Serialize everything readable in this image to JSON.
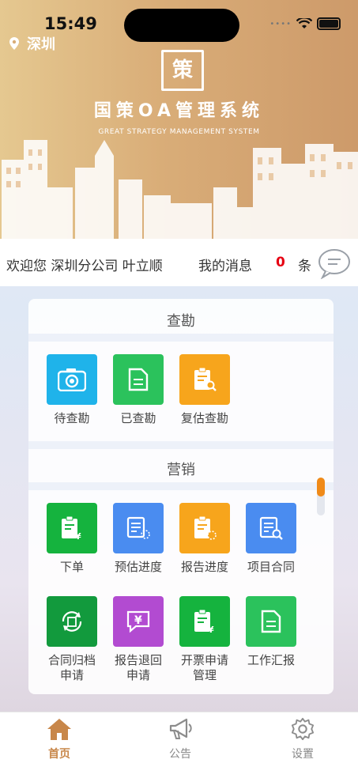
{
  "status_bar": {
    "time": "15:49"
  },
  "location": {
    "city": "深圳",
    "icon": "location-pin-icon"
  },
  "brand": {
    "logo_text": "策",
    "title": "国策OA管理系统",
    "subtitle": "GREAT STRATEGY MANAGEMENT SYSTEM"
  },
  "welcome": {
    "text": "欢迎您 深圳分公司 叶立顺",
    "message_label": "我的消息",
    "message_count": "0",
    "message_unit": "条"
  },
  "sections": [
    {
      "title": "查勘",
      "items": [
        {
          "label": "待查勘",
          "icon": "camera-icon",
          "color": "#1fb3ea"
        },
        {
          "label": "已查勘",
          "icon": "document-icon",
          "color": "#2bc25c"
        },
        {
          "label": "复估查勘",
          "icon": "clipboard-search-icon",
          "color": "#f7a51c"
        }
      ]
    },
    {
      "title": "营销",
      "items": [
        {
          "label": "下单",
          "icon": "clipboard-yen-icon",
          "color": "#15b33e"
        },
        {
          "label": "预估进度",
          "icon": "list-progress-icon",
          "color": "#4a8cf0"
        },
        {
          "label": "报告进度",
          "icon": "clipboard-progress-icon",
          "color": "#f7a51c"
        },
        {
          "label": "项目合同",
          "icon": "list-search-icon",
          "color": "#4a8cf0"
        },
        {
          "label": "合同归档申请",
          "label_line1": "合同归档",
          "label_line2": "申请",
          "icon": "archive-refresh-icon",
          "color": "#129a3d"
        },
        {
          "label": "报告退回申请",
          "label_line1": "报告退回",
          "label_line2": "申请",
          "icon": "yen-chat-icon",
          "color": "#b24bd1"
        },
        {
          "label": "开票申请管理",
          "label_line1": "开票申请",
          "label_line2": "管理",
          "icon": "clipboard-yen-icon",
          "color": "#15b33e"
        },
        {
          "label": "工作汇报",
          "icon": "document-icon",
          "color": "#2bc25c"
        }
      ]
    }
  ],
  "tabs": [
    {
      "label": "首页",
      "icon": "home-icon",
      "active": true
    },
    {
      "label": "公告",
      "icon": "megaphone-icon",
      "active": false
    },
    {
      "label": "设置",
      "icon": "gear-icon",
      "active": false
    }
  ],
  "colors": {
    "accent": "#c8874a",
    "message_count": "#e60012",
    "scroll_thumb": "#f08a18"
  }
}
